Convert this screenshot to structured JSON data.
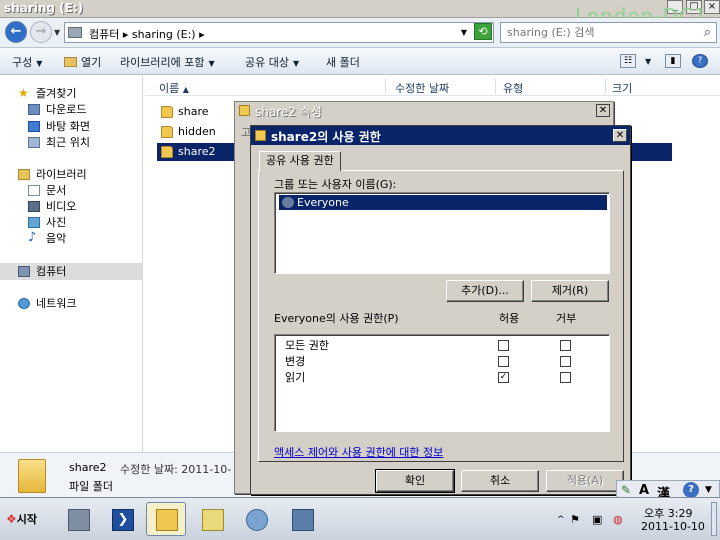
{
  "window": {
    "title": "sharing (E:)"
  },
  "watermark": "London-DC1",
  "address": {
    "crumbs": "컴퓨터 ▸ sharing (E:) ▸",
    "search_placeholder": "sharing (E:) 검색"
  },
  "toolbar": {
    "organize": "구성",
    "open": "열기",
    "include_library": "라이브러리에 포함",
    "share_with": "공유 대상",
    "new_folder": "새 폴더"
  },
  "nav": {
    "favorites": "즐겨찾기",
    "favorites_items": [
      "다운로드",
      "바탕 화면",
      "최근 위치"
    ],
    "libraries": "라이브러리",
    "libraries_items": [
      "문서",
      "비디오",
      "사진",
      "음악"
    ],
    "computer": "컴퓨터",
    "network": "네트워크"
  },
  "columns": {
    "name": "이름",
    "modified": "수정한 날짜",
    "type": "유형",
    "size": "크기"
  },
  "files": [
    "share",
    "hidden",
    "share2"
  ],
  "details": {
    "name": "share2",
    "modified": "수정한 날짜: 2011-10-",
    "type": "파일 폴더"
  },
  "prop_dialog": {
    "title": "share2 속성",
    "tab_hint": "고"
  },
  "perm_dialog": {
    "title": "share2의 사용 권한",
    "tab": "공유 사용 권한",
    "group_label": "그룹 또는 사용자 이름(G):",
    "users": [
      "Everyone"
    ],
    "add_button": "추가(D)...",
    "remove_button": "제거(R)",
    "perm_label": "Everyone의 사용 권한(P)",
    "allow": "허용",
    "deny": "거부",
    "permissions": [
      {
        "name": "모든 권한",
        "allow": "",
        "deny": ""
      },
      {
        "name": "변경",
        "allow": "",
        "deny": ""
      },
      {
        "name": "읽기",
        "allow": "✓",
        "deny": ""
      }
    ],
    "link": "액세스 제어와 사용 권한에 대한 정보",
    "ok": "확인",
    "cancel": "취소",
    "apply": "적용(A)"
  },
  "taskbar": {
    "start": "시작",
    "time": "오후 3:29",
    "date": "2011-10-10"
  },
  "lang_bar": {
    "a": "A",
    "han": "漢"
  }
}
